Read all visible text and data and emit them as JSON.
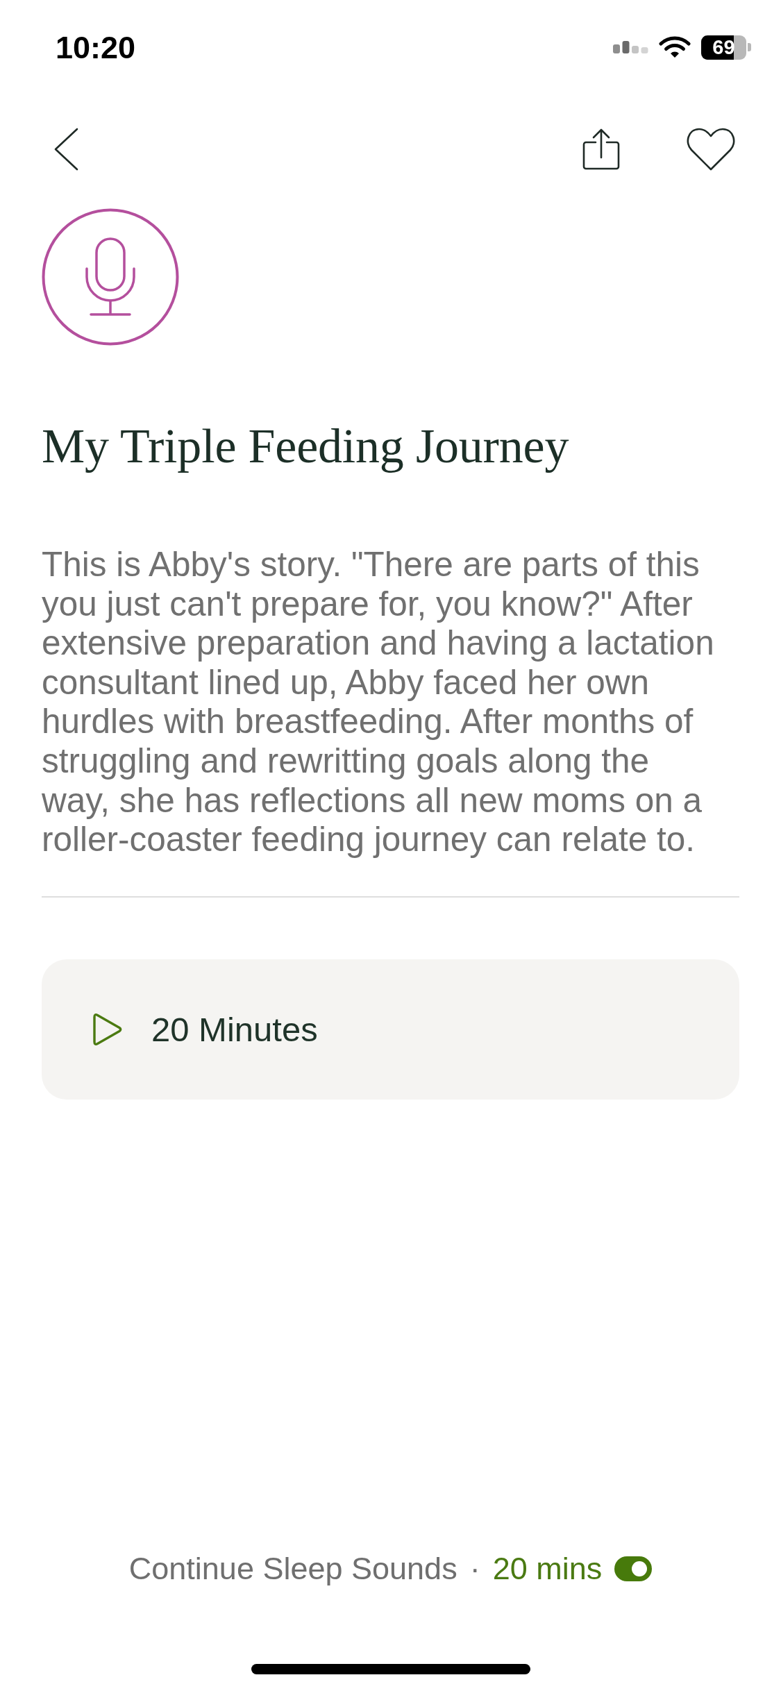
{
  "status_bar": {
    "time": "10:20",
    "battery": "69"
  },
  "actions": {
    "favorited": false
  },
  "episode": {
    "title": "My Triple Feeding Journey",
    "description": "This is Abby's story. \"There are parts of this you just can't prepare for, you know?\" After extensive preparation and having a lactation consultant lined up, Abby faced her own hurdles with breastfeeding. After months of struggling and rewritting goals along the way, she has reflections all new moms on a roller-coaster feeding journey can relate to."
  },
  "player": {
    "duration": "20 Minutes"
  },
  "sleep_sounds": {
    "label": "Continue Sleep Sounds",
    "separator": "·",
    "duration": "20 mins",
    "on": true
  }
}
